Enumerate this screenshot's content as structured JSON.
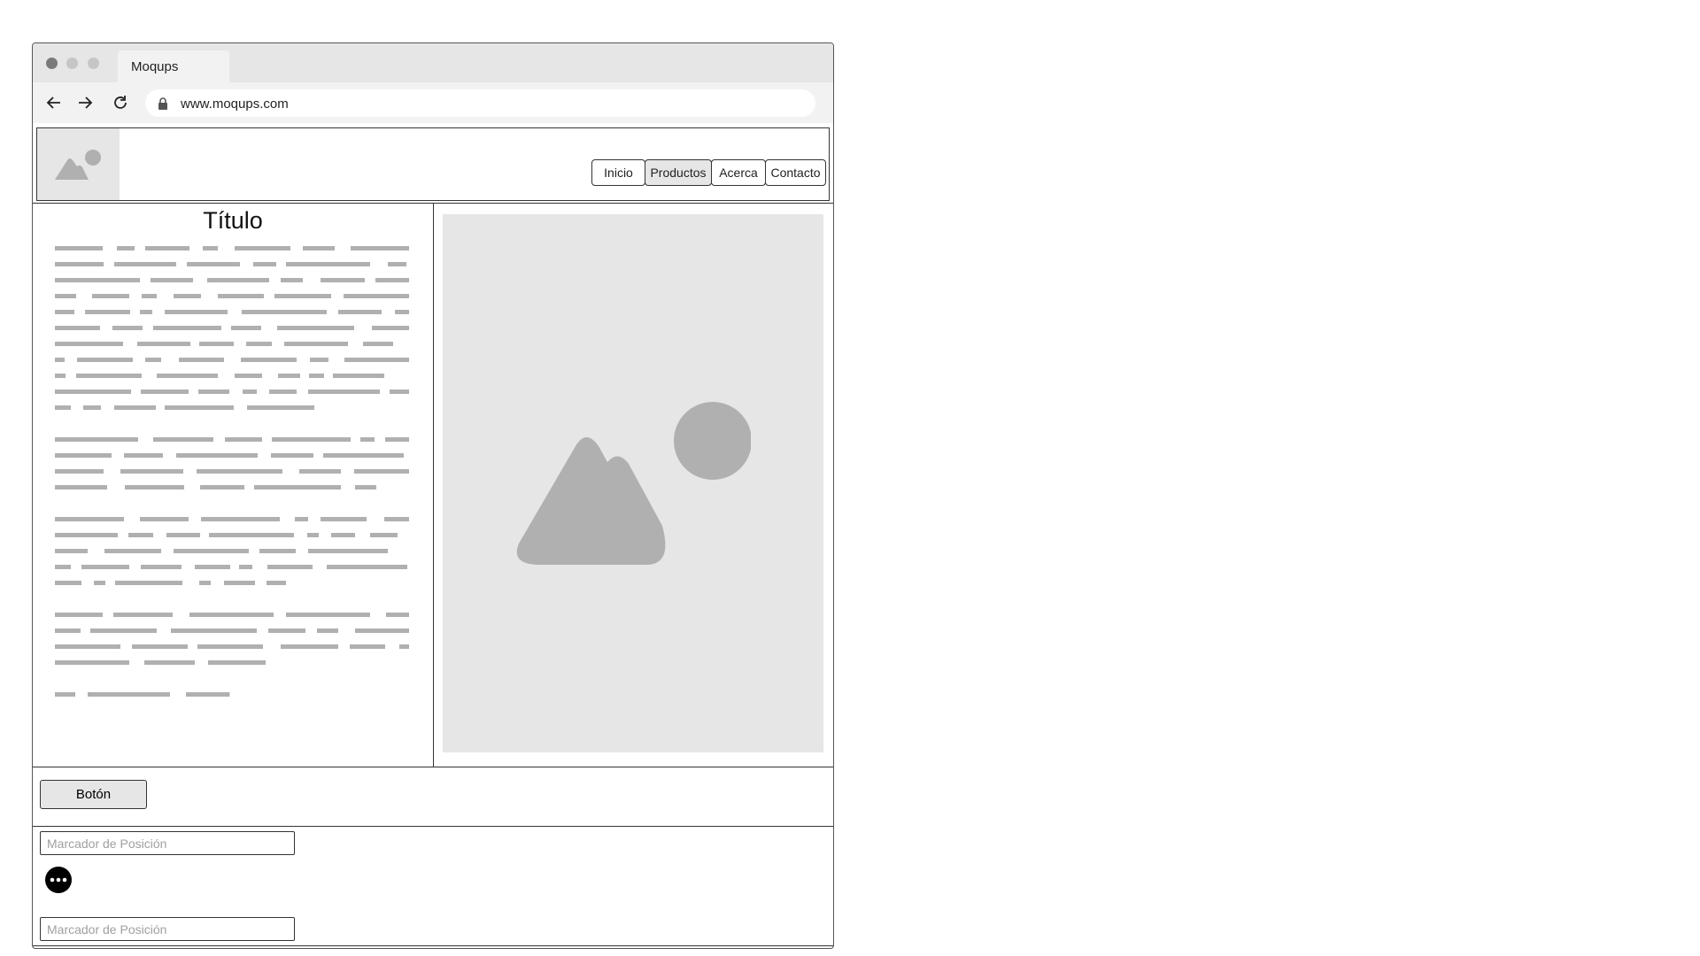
{
  "browser": {
    "tab_title": "Moqups",
    "url": "www.moqups.com"
  },
  "header": {
    "menu": [
      {
        "label": "Inicio",
        "active": false
      },
      {
        "label": "Productos",
        "active": true
      },
      {
        "label": "Acerca",
        "active": false
      },
      {
        "label": "Contacto",
        "active": false
      }
    ]
  },
  "main": {
    "title": "Título"
  },
  "actions": {
    "button_label": "Botón"
  },
  "form": {
    "field1_placeholder": "Marcador de Posición",
    "field2_placeholder": "Marcador de Posición"
  },
  "colors": {
    "placeholder_gray": "#e6e6e6",
    "icon_gray": "#b0b0b0",
    "border": "#333333"
  },
  "icons": [
    "back-arrow-icon",
    "forward-arrow-icon",
    "reload-icon",
    "lock-icon",
    "image-placeholder-icon",
    "more-options-icon"
  ]
}
